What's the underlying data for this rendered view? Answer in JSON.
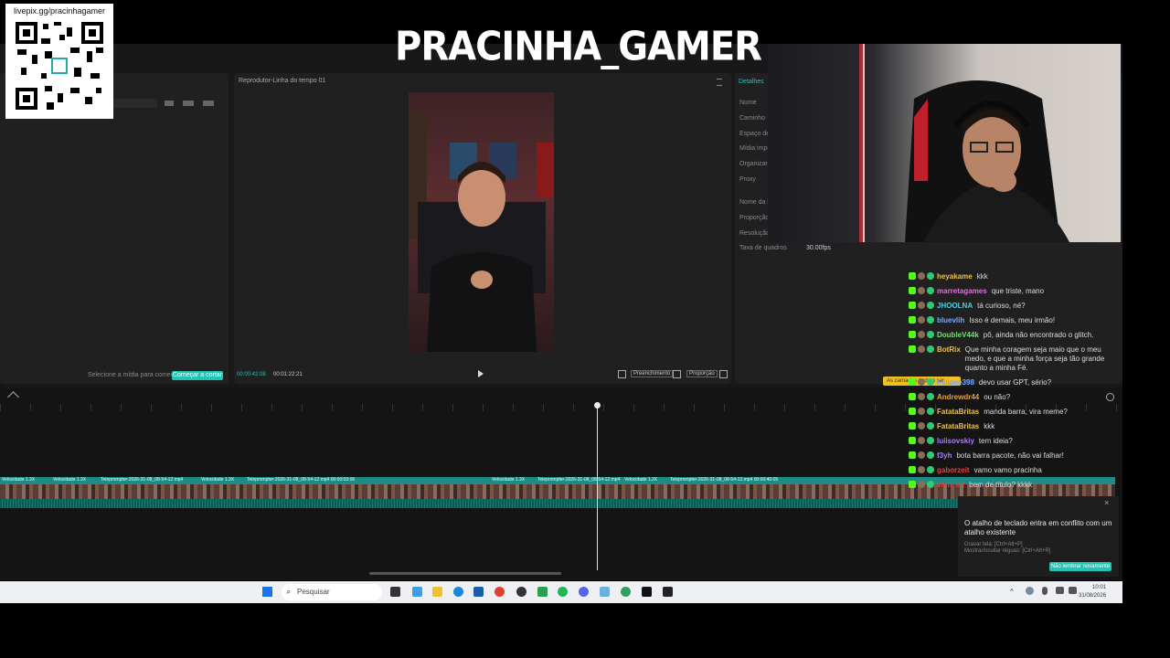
{
  "overlay": {
    "channel_title": "PRACINHA_GAMER",
    "qr_url": "livepix.gg/pracinhagamer"
  },
  "editor": {
    "player_title": "Reprodutor-Linha do tempo 01",
    "details_tab": "Detalhes",
    "media_prompt": "Selecione a mídia para começar",
    "start_button": "Começar a cortar",
    "current_time": "00:00:42:08",
    "total_time": "00:01:22:21",
    "fill_label": "Preenchimento",
    "ratio_label": "Proporção",
    "detail_labels": [
      "Nome",
      "Caminho",
      "Espaço de c",
      "Mídia impor",
      "Organizar c",
      "Proxy",
      "Nome da li",
      "Proporção c",
      "Resolução",
      "Taxa de quadros"
    ],
    "frame_rate": "30.00fps",
    "track_labels": [
      "Velocidade 1.3X",
      "Velocidade 1.3X",
      "Teleprompter-2026-31-08_08-54-12.mp4",
      "Velocidade 1.3X",
      "Teleprompter-2026-31-08_08-54-12.mp4 00:00:03:06",
      "Velocidade 1.3X",
      "Teleprompter-2026-31-08_08-54-12.mp4",
      "Velocidade 1.3X",
      "Teleprompter-2026-31-08_08-54-12.mp4 00:00:40:05"
    ],
    "hint_toast": "As camadas podem ser"
  },
  "chat": [
    {
      "user": "heyakame",
      "color": "#f0c040",
      "msg": "kkk"
    },
    {
      "user": "marretagames",
      "color": "#e070e0",
      "msg": "que triste, mano"
    },
    {
      "user": "JHOOLNA",
      "color": "#4ecfe0",
      "msg": "tá curioso, né?"
    },
    {
      "user": "bluevlih",
      "color": "#7aa8ff",
      "msg": "Isso é demais, meu irmão!"
    },
    {
      "user": "DoubleV44k",
      "color": "#6fe36f",
      "msg": "pô, ainda não encontrado o glitch."
    },
    {
      "user": "BotRix",
      "color": "#f0c040",
      "msg": "Que minha coragem seja maio que o meu medo, e que a minha força seja tão grande quanto a minha Fé."
    },
    {
      "user": "Felipee398",
      "color": "#7aa8ff",
      "msg": "devo usar GPT, sério?"
    },
    {
      "user": "Andrewdr44",
      "color": "#f0a030",
      "msg": "ou não?"
    },
    {
      "user": "FatataBritas",
      "color": "#f0c040",
      "msg": "manda barra, vira meme?"
    },
    {
      "user": "FatataBritas",
      "color": "#f0c040",
      "msg": "kkk"
    },
    {
      "user": "luiisovskiy",
      "color": "#b07aff",
      "msg": "tem ideia?"
    },
    {
      "user": "f3yh",
      "color": "#b07aff",
      "msg": "bota barra pacote, não vai falhar!"
    },
    {
      "user": "gaborzeit",
      "color": "#e04040",
      "msg": "vamo vamo pracinha"
    },
    {
      "user": "vinn_elf",
      "color": "#e04040",
      "msg": "bem de título? kkkk"
    }
  ],
  "notification": {
    "title": "O atalho de teclado entra em conflito com um atalho existente",
    "line1": "Gravar tela: [Ctrl+Alt+P]",
    "line2": "Mostrar/ocultar réguas: [Ctrl+Alt+R]",
    "button": "Não lembrar novamente"
  },
  "taskbar": {
    "search_placeholder": "Pesquisar",
    "time": "10:01",
    "date": "31/08/2026"
  }
}
